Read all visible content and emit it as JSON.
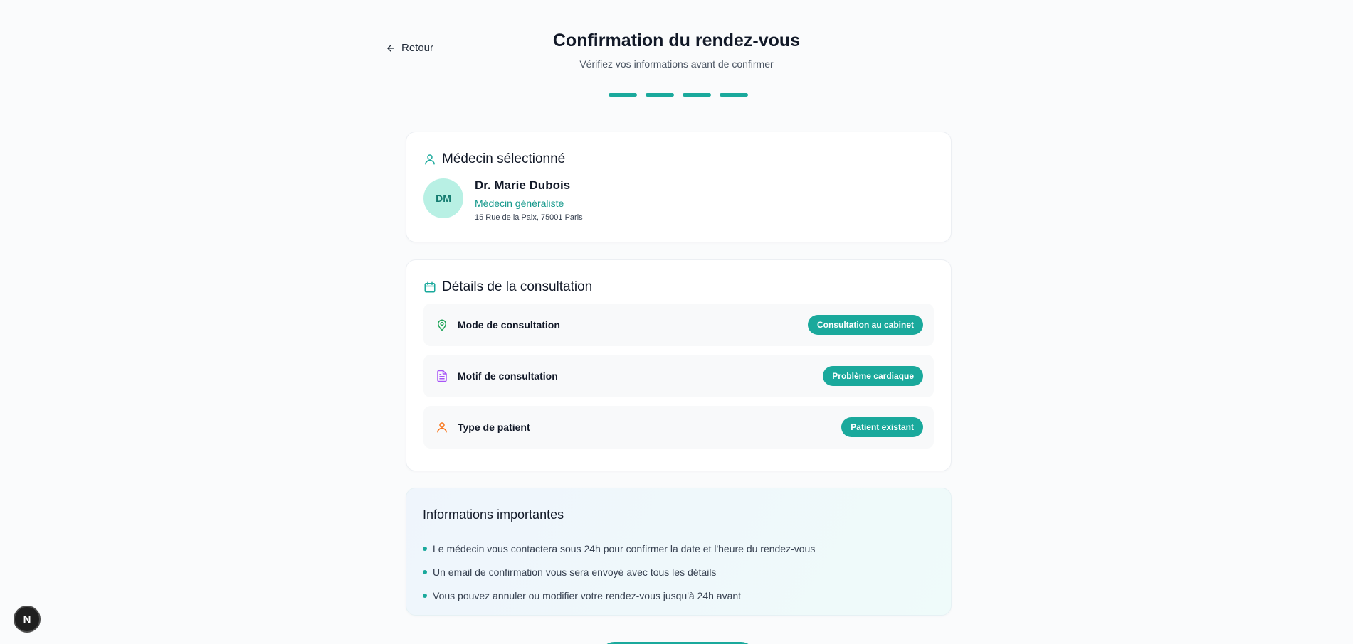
{
  "nav": {
    "back_label": "Retour"
  },
  "header": {
    "title": "Confirmation du rendez-vous",
    "subtitle": "Vérifiez vos informations avant de confirmer",
    "steps_total": 4,
    "steps_completed": 4
  },
  "doctor": {
    "section_title": "Médecin sélectionné",
    "initials": "DM",
    "name": "Dr. Marie Dubois",
    "specialty": "Médecin généraliste",
    "address": "15 Rue de la Paix, 75001 Paris"
  },
  "details": {
    "section_title": "Détails de la consultation",
    "rows": [
      {
        "label": "Mode de consultation",
        "value": "Consultation au cabinet",
        "icon": "map-pin-icon",
        "icon_color": "#22a55a"
      },
      {
        "label": "Motif de consultation",
        "value": "Problème cardiaque",
        "icon": "file-text-icon",
        "icon_color": "#a855f7"
      },
      {
        "label": "Type de patient",
        "value": "Patient existant",
        "icon": "user-icon",
        "icon_color": "#f97316"
      }
    ]
  },
  "info": {
    "title": "Informations importantes",
    "items": [
      "Le médecin vous contactera sous 24h pour confirmer la date et l'heure du rendez-vous",
      "Un email de confirmation vous sera envoyé avec tous les détails",
      "Vous pouvez annuler ou modifier votre rendez-vous jusqu'à 24h avant"
    ]
  },
  "dev_badge": {
    "label": "N"
  },
  "colors": {
    "accent": "#1aa99c",
    "avatar_bg": "#b8f0e4"
  }
}
